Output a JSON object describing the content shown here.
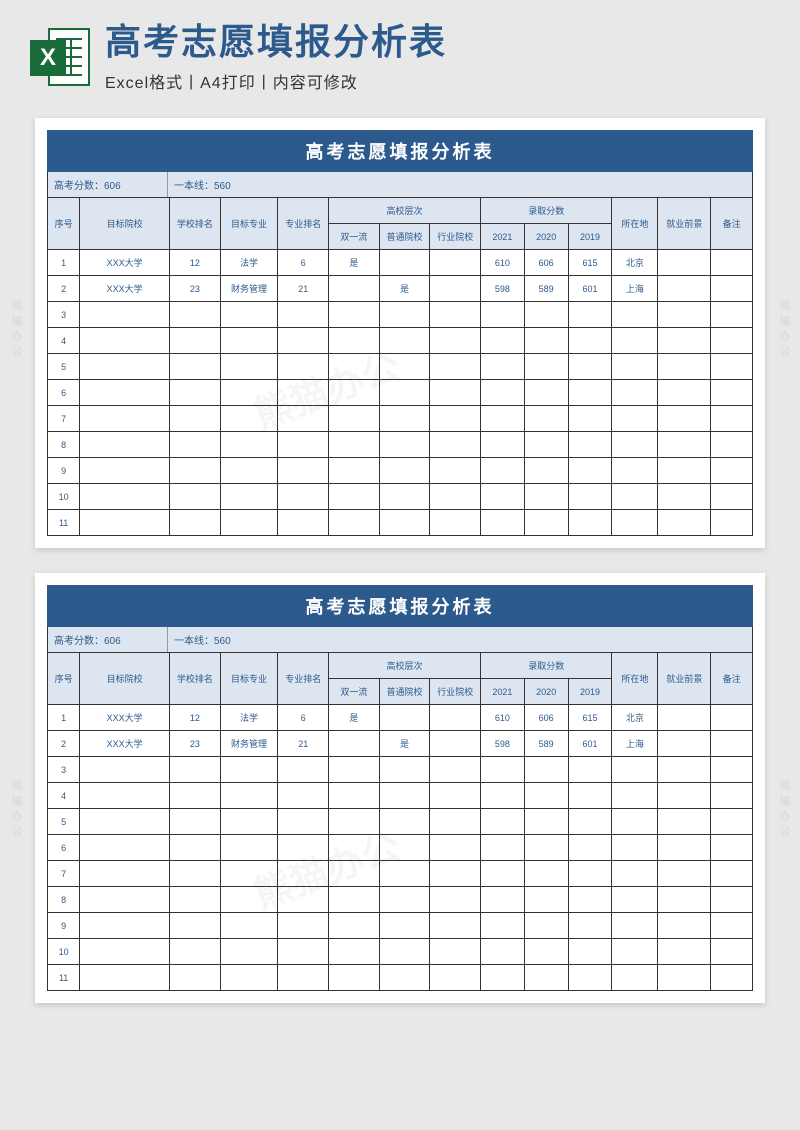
{
  "header": {
    "icon_letter": "X",
    "main_title": "高考志愿填报分析表",
    "sub_title": "Excel格式丨A4打印丨内容可修改"
  },
  "sheet": {
    "title": "高考志愿填报分析表",
    "info": {
      "score_label": "高考分数：606",
      "line_label": "一本线：560"
    },
    "columns": {
      "seq": "序号",
      "school": "目标院校",
      "school_rank": "学校排名",
      "major": "目标专业",
      "major_rank": "专业排名",
      "level_group": "高校层次",
      "level_a": "双一流",
      "level_b": "普通院校",
      "level_c": "行业院校",
      "score_group": "录取分数",
      "y2021": "2021",
      "y2020": "2020",
      "y2019": "2019",
      "location": "所在地",
      "prospect": "就业前景",
      "note": "备注"
    },
    "rows": [
      {
        "seq": "1",
        "school": "XXX大学",
        "school_rank": "12",
        "major": "法学",
        "major_rank": "6",
        "la": "是",
        "lb": "",
        "lc": "",
        "y1": "610",
        "y2": "606",
        "y3": "615",
        "loc": "北京",
        "job": "",
        "note": ""
      },
      {
        "seq": "2",
        "school": "XXX大学",
        "school_rank": "23",
        "major": "财务管理",
        "major_rank": "21",
        "la": "",
        "lb": "是",
        "lc": "",
        "y1": "598",
        "y2": "589",
        "y3": "601",
        "loc": "上海",
        "job": "",
        "note": ""
      },
      {
        "seq": "3",
        "school": "",
        "school_rank": "",
        "major": "",
        "major_rank": "",
        "la": "",
        "lb": "",
        "lc": "",
        "y1": "",
        "y2": "",
        "y3": "",
        "loc": "",
        "job": "",
        "note": ""
      },
      {
        "seq": "4",
        "school": "",
        "school_rank": "",
        "major": "",
        "major_rank": "",
        "la": "",
        "lb": "",
        "lc": "",
        "y1": "",
        "y2": "",
        "y3": "",
        "loc": "",
        "job": "",
        "note": ""
      },
      {
        "seq": "5",
        "school": "",
        "school_rank": "",
        "major": "",
        "major_rank": "",
        "la": "",
        "lb": "",
        "lc": "",
        "y1": "",
        "y2": "",
        "y3": "",
        "loc": "",
        "job": "",
        "note": ""
      },
      {
        "seq": "6",
        "school": "",
        "school_rank": "",
        "major": "",
        "major_rank": "",
        "la": "",
        "lb": "",
        "lc": "",
        "y1": "",
        "y2": "",
        "y3": "",
        "loc": "",
        "job": "",
        "note": ""
      },
      {
        "seq": "7",
        "school": "",
        "school_rank": "",
        "major": "",
        "major_rank": "",
        "la": "",
        "lb": "",
        "lc": "",
        "y1": "",
        "y2": "",
        "y3": "",
        "loc": "",
        "job": "",
        "note": ""
      },
      {
        "seq": "8",
        "school": "",
        "school_rank": "",
        "major": "",
        "major_rank": "",
        "la": "",
        "lb": "",
        "lc": "",
        "y1": "",
        "y2": "",
        "y3": "",
        "loc": "",
        "job": "",
        "note": ""
      },
      {
        "seq": "9",
        "school": "",
        "school_rank": "",
        "major": "",
        "major_rank": "",
        "la": "",
        "lb": "",
        "lc": "",
        "y1": "",
        "y2": "",
        "y3": "",
        "loc": "",
        "job": "",
        "note": ""
      },
      {
        "seq": "10",
        "school": "",
        "school_rank": "",
        "major": "",
        "major_rank": "",
        "la": "",
        "lb": "",
        "lc": "",
        "y1": "",
        "y2": "",
        "y3": "",
        "loc": "",
        "job": "",
        "note": ""
      },
      {
        "seq": "11",
        "school": "",
        "school_rank": "",
        "major": "",
        "major_rank": "",
        "la": "",
        "lb": "",
        "lc": "",
        "y1": "",
        "y2": "",
        "y3": "",
        "loc": "",
        "job": "",
        "note": ""
      }
    ]
  },
  "watermark": "熊猫办公",
  "chart_data": {
    "type": "table",
    "title": "高考志愿填报分析表",
    "meta": {
      "高考分数": 606,
      "一本线": 560
    },
    "columns": [
      "序号",
      "目标院校",
      "学校排名",
      "目标专业",
      "专业排名",
      "双一流",
      "普通院校",
      "行业院校",
      "2021",
      "2020",
      "2019",
      "所在地",
      "就业前景",
      "备注"
    ],
    "rows": [
      [
        1,
        "XXX大学",
        12,
        "法学",
        6,
        "是",
        "",
        "",
        610,
        606,
        615,
        "北京",
        "",
        ""
      ],
      [
        2,
        "XXX大学",
        23,
        "财务管理",
        21,
        "",
        "是",
        "",
        598,
        589,
        601,
        "上海",
        "",
        ""
      ]
    ]
  }
}
